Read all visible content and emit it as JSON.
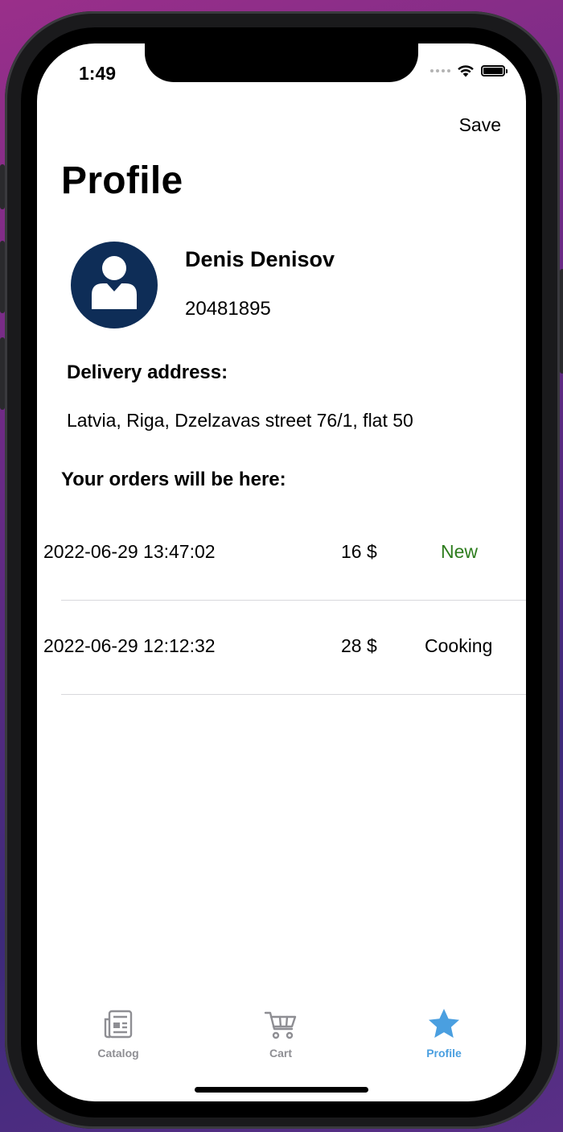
{
  "status_bar": {
    "time": "1:49"
  },
  "nav": {
    "save_label": "Save",
    "title": "Profile"
  },
  "user": {
    "name": "Denis Denisov",
    "phone": "20481895",
    "avatar_icon": "user-avatar-icon"
  },
  "delivery": {
    "label": "Delivery address:",
    "address": "Latvia, Riga, Dzelzavas street 76/1, flat 50"
  },
  "orders": {
    "title": "Your orders will be here:",
    "items": [
      {
        "date": "2022-06-29 13:47:02",
        "price": "16 $",
        "status": "New",
        "status_color": "#2e7d1e"
      },
      {
        "date": "2022-06-29 12:12:32",
        "price": "28 $",
        "status": "Cooking",
        "status_color": "#000000"
      }
    ]
  },
  "tabs": [
    {
      "label": "Catalog",
      "icon": "newspaper-icon",
      "active": false
    },
    {
      "label": "Cart",
      "icon": "cart-icon",
      "active": false
    },
    {
      "label": "Profile",
      "icon": "star-icon",
      "active": true
    }
  ],
  "colors": {
    "accent": "#4a9fe0",
    "inactive": "#8e8e93",
    "avatar_bg": "#0e2d57",
    "status_new": "#2e7d1e"
  }
}
